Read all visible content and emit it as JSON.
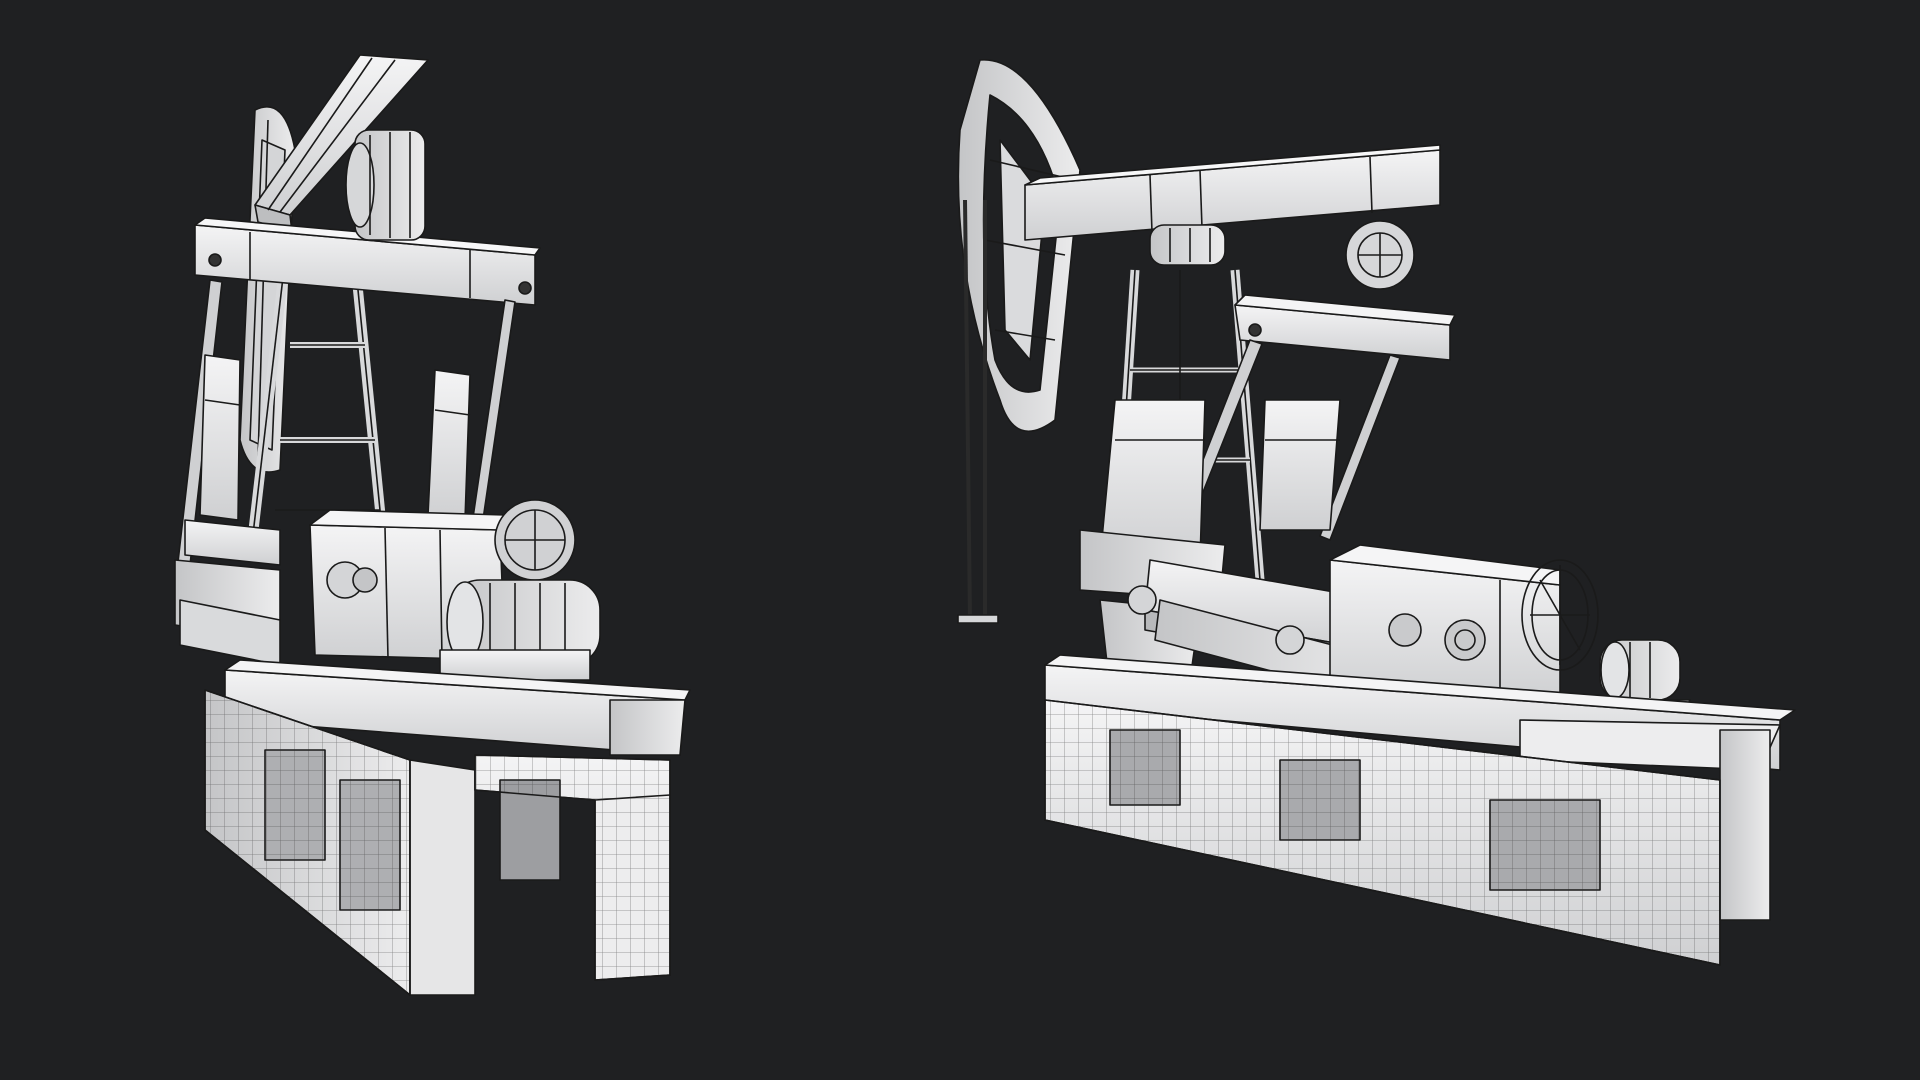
{
  "scene": {
    "background_color": "#1f2022",
    "subject": "wireframe-render",
    "models": [
      {
        "name": "pump-jack-rear-three-quarter"
      },
      {
        "name": "pump-jack-side-three-quarter"
      }
    ]
  },
  "colors": {
    "surface": "#e9e9ea",
    "surface_shadow": "#b9babc",
    "surface_dark": "#8f9093",
    "wire": "#1a1a1a",
    "cable": "#2a2a2a"
  }
}
